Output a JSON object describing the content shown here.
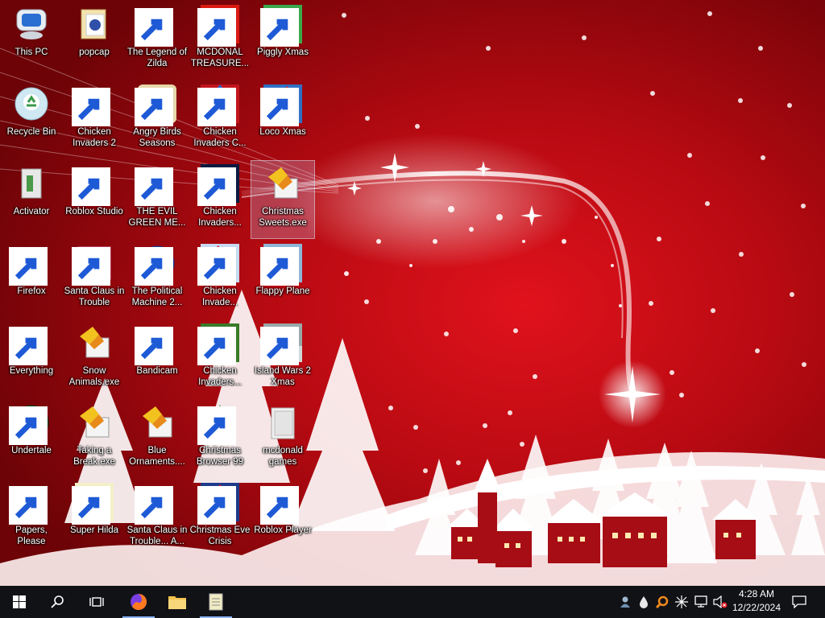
{
  "desktop": {
    "icons": [
      {
        "id": "this-pc",
        "label": "This PC"
      },
      {
        "id": "popcap",
        "label": "popcap"
      },
      {
        "id": "legend-of-zilda",
        "label": "The Legend of Zilda"
      },
      {
        "id": "mcdonald-treasure",
        "label": "MCDONAL TREASURE..."
      },
      {
        "id": "piggly-xmas",
        "label": "Piggly Xmas"
      },
      {
        "id": "recycle-bin",
        "label": "Recycle Bin"
      },
      {
        "id": "chicken-invaders-2",
        "label": "Chicken Invaders 2"
      },
      {
        "id": "angry-birds-seasons",
        "label": "Angry Birds Seasons"
      },
      {
        "id": "chicken-invaders-c",
        "label": "Chicken Invaders C..."
      },
      {
        "id": "loco-xmas",
        "label": "Loco Xmas"
      },
      {
        "id": "activator",
        "label": "Activator"
      },
      {
        "id": "roblox-studio",
        "label": "Roblox Studio"
      },
      {
        "id": "the-evil-green-me",
        "label": "THE EVIL GREEN ME..."
      },
      {
        "id": "chicken-invaders-r1c3",
        "label": "Chicken Invaders..."
      },
      {
        "id": "christmas-sweets",
        "label": "Christmas Sweets.exe"
      },
      {
        "id": "firefox",
        "label": "Firefox"
      },
      {
        "id": "santa-claus-trouble",
        "label": "Santa Claus in Trouble"
      },
      {
        "id": "political-machine",
        "label": "The Political Machine 2..."
      },
      {
        "id": "chicken-invade-r3",
        "label": "Chicken Invade..."
      },
      {
        "id": "flappy-plane",
        "label": "Flappy Plane"
      },
      {
        "id": "everything",
        "label": "Everything"
      },
      {
        "id": "snow-animals",
        "label": "Snow Animals.exe"
      },
      {
        "id": "bandicam",
        "label": "Bandicam"
      },
      {
        "id": "chicken-invaders-r4",
        "label": "Chicken Invaders..."
      },
      {
        "id": "island-wars-2",
        "label": "Island Wars 2 Xmas"
      },
      {
        "id": "undertale",
        "label": "Undertale"
      },
      {
        "id": "taking-a-break",
        "label": "Taking a Break.exe"
      },
      {
        "id": "blue-ornaments",
        "label": "Blue Ornaments...."
      },
      {
        "id": "christmas-browser-99",
        "label": "Christmas Browser 99"
      },
      {
        "id": "mcdonald-games",
        "label": "mcdonald games"
      },
      {
        "id": "papers-please",
        "label": "Papers, Please"
      },
      {
        "id": "super-hilda",
        "label": "Super Hilda"
      },
      {
        "id": "santa-claus-trouble-a",
        "label": "Santa Claus in Trouble... A..."
      },
      {
        "id": "christmas-eve-crisis",
        "label": "Christmas Eve Crisis"
      },
      {
        "id": "roblox-player",
        "label": "Roblox Player"
      }
    ]
  },
  "taskbar": {
    "start_icon": "windows-logo-icon",
    "search_icon": "search-icon",
    "task_view_icon": "task-view-icon",
    "pinned": [
      "firefox-icon",
      "file-explorer-icon",
      "notepad-icon"
    ],
    "tray_icons": [
      "avatar-tray-icon",
      "droplet-icon",
      "everything-search-icon",
      "sparkle-icon",
      "network-icon",
      "volume-muted-icon"
    ],
    "clock": {
      "time": "4:28 AM",
      "date": "12/22/2024"
    },
    "notification_icon": "notification-icon"
  },
  "colors": {
    "taskbar": "#111216",
    "wallpaper_red": "#c8101a",
    "label": "#ffffff"
  }
}
